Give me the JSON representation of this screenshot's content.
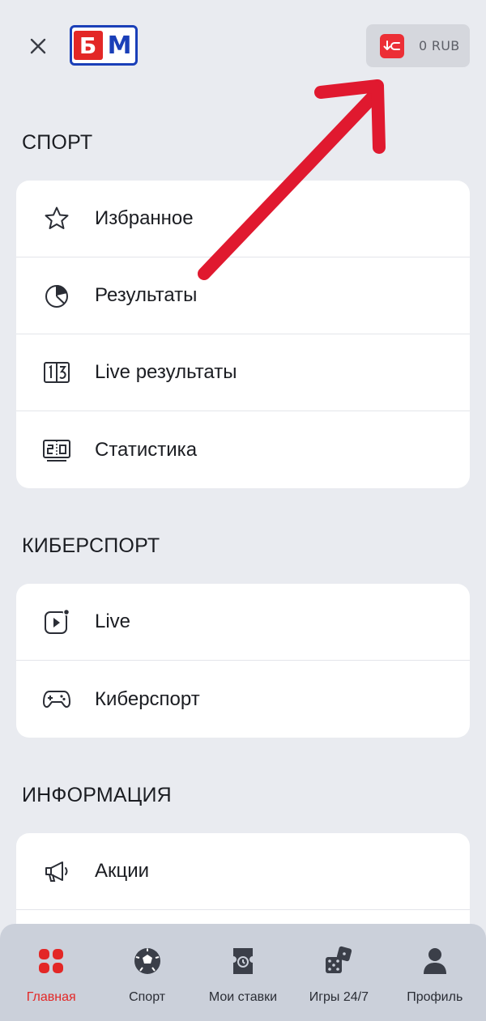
{
  "header": {
    "logo_text": "БМ",
    "wallet": {
      "balance": "0 RUB"
    }
  },
  "sections": [
    {
      "title": "СПОРТ",
      "items": [
        {
          "label": "Избранное",
          "icon": "star-icon"
        },
        {
          "label": "Результаты",
          "icon": "pie-chart-icon"
        },
        {
          "label": "Live результаты",
          "icon": "scoreboard-icon"
        },
        {
          "label": "Статистика",
          "icon": "score-display-icon"
        }
      ]
    },
    {
      "title": "КИБЕРСПОРТ",
      "items": [
        {
          "label": "Live",
          "icon": "live-play-icon"
        },
        {
          "label": "Киберспорт",
          "icon": "gamepad-icon"
        }
      ]
    },
    {
      "title": "ИНФОРМАЦИЯ",
      "items": [
        {
          "label": "Акции",
          "icon": "megaphone-icon"
        }
      ]
    }
  ],
  "tabbar": {
    "items": [
      {
        "label": "Главная",
        "icon": "home-grid-icon",
        "active": true
      },
      {
        "label": "Спорт",
        "icon": "soccer-ball-icon",
        "active": false
      },
      {
        "label": "Мои ставки",
        "icon": "ticket-icon",
        "active": false
      },
      {
        "label": "Игры 24/7",
        "icon": "dice-icon",
        "active": false
      },
      {
        "label": "Профиль",
        "icon": "user-icon",
        "active": false
      }
    ]
  },
  "colors": {
    "accent": "#e32726",
    "brand_blue": "#1a3fb8",
    "background": "#e9ebf0",
    "tabbar": "#cbd0da",
    "annotation_arrow": "#e0192f"
  }
}
